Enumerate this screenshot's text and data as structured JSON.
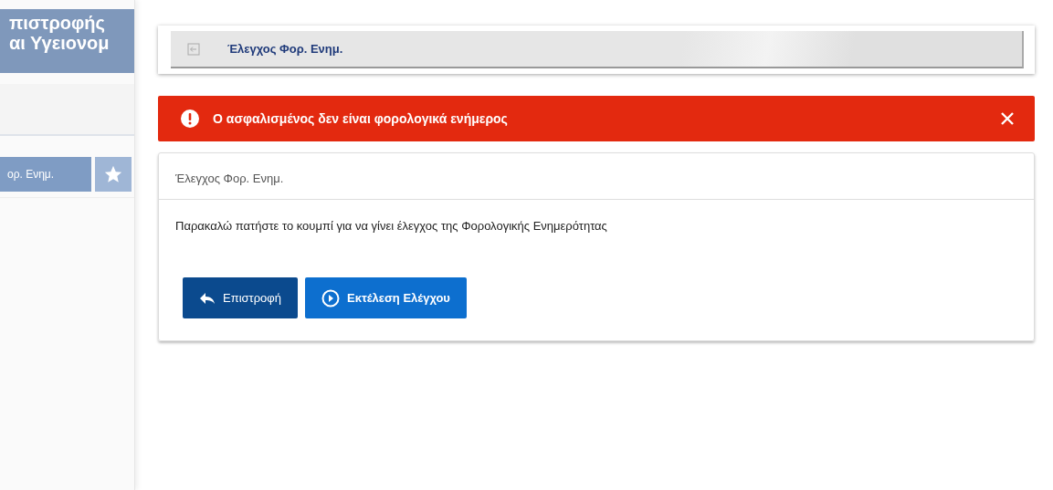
{
  "sidebar": {
    "title_lines": [
      "πιστροφής",
      "αι Υγειονομ"
    ],
    "tab": {
      "label": "ορ. Ενημ.",
      "selected": true
    }
  },
  "breadcrumb": {
    "label": "Έλεγχος Φορ. Ενημ."
  },
  "alert": {
    "message": "Ο ασφαλισμένος δεν είναι φορολογικά ενήμερος"
  },
  "panel": {
    "title": "Έλεγχος Φορ. Ενημ.",
    "message": "Παρακαλώ πατήστε το κουμπί για να γίνει έλεγχος της Φορολογικής Ενημερότητας",
    "buttons": [
      {
        "kind": "back",
        "label": "Επιστροφή"
      },
      {
        "kind": "run",
        "label": "Εκτέλεση Ελέγχου"
      }
    ]
  }
}
